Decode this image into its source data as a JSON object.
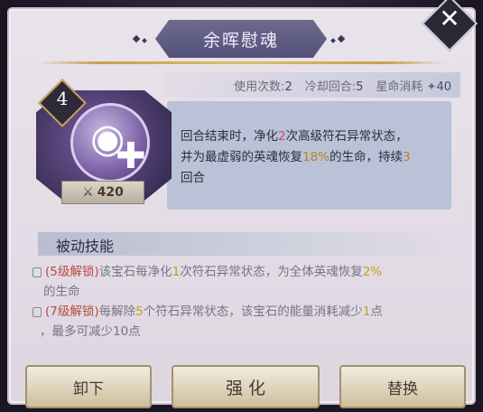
{
  "title": "余晖慰魂",
  "stats": {
    "uses_label": "使用次数:",
    "uses_value": "2",
    "cooldown_label": "冷却回合:",
    "cooldown_value": "5",
    "star_cost_label": "星命消耗",
    "star_cost_value": "40"
  },
  "skill": {
    "level": "4",
    "cost": "420",
    "desc": {
      "p1": "回合结束时，净化",
      "n1": "2",
      "p2": "次高级符石异常状态，",
      "p3": "并为最虚弱的英魂恢复",
      "n2": "18%",
      "p4": "的生命，持续",
      "n3": "3",
      "p5": "回合"
    }
  },
  "passive": {
    "heading": "被动技能",
    "items": [
      {
        "unlock": "(5级解锁)",
        "t1": "该宝石每净化",
        "n1": "1",
        "t2": "次符石异常状态，为全体英魂恢复",
        "n2": "2%",
        "t3": "的生命"
      },
      {
        "unlock": "(7级解锁)",
        "t1": "每解除",
        "n1": "5",
        "t2": "个符石异常状态，该宝石的能量消耗减少",
        "n2": "1",
        "t3": "点",
        "t4": "，最多可减少10点"
      }
    ]
  },
  "buttons": {
    "unequip": "卸下",
    "enhance": "强 化",
    "replace": "替换"
  },
  "icons": [
    "close-icon",
    "lock-icon",
    "star-icon",
    "crossed-swords-icon",
    "soul-heal-icon"
  ]
}
